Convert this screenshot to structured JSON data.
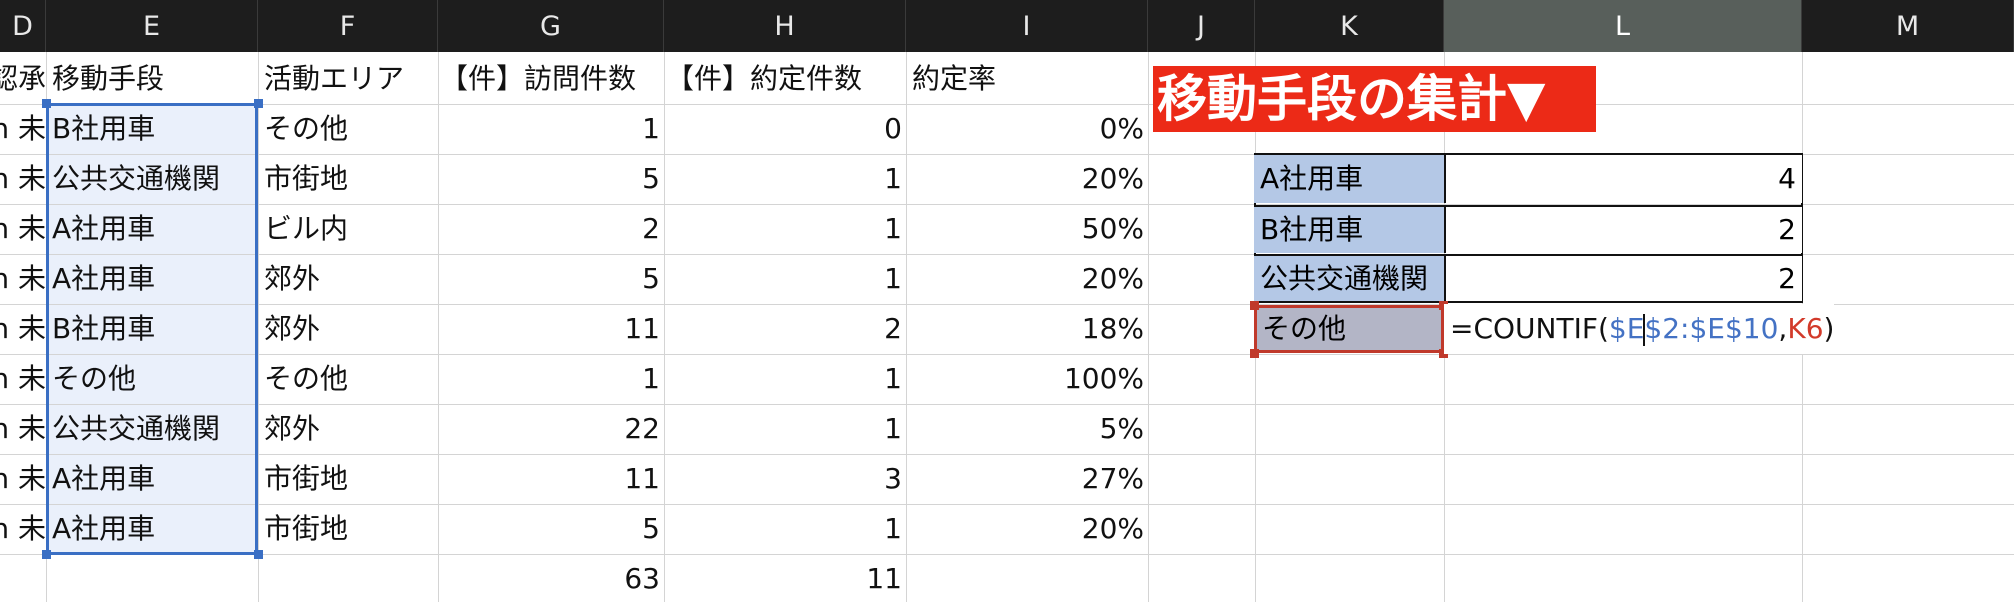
{
  "column_headers": [
    "D",
    "E",
    "F",
    "G",
    "H",
    "I",
    "J",
    "K",
    "L",
    "M"
  ],
  "header_row": {
    "d_partial": "認承",
    "e": "移動手段",
    "f": "活動エリア",
    "g": "【件】訪問件数",
    "h": "【件】約定件数",
    "i": "約定率"
  },
  "rows": [
    {
      "d": "n 未",
      "e": "B社用車",
      "f": "その他",
      "g": "1",
      "h": "0",
      "i": "0%"
    },
    {
      "d": "n 未",
      "e": "公共交通機関",
      "f": "市街地",
      "g": "5",
      "h": "1",
      "i": "20%"
    },
    {
      "d": "n 未",
      "e": "A社用車",
      "f": "ビル内",
      "g": "2",
      "h": "1",
      "i": "50%"
    },
    {
      "d": "n 未",
      "e": "A社用車",
      "f": "郊外",
      "g": "5",
      "h": "1",
      "i": "20%"
    },
    {
      "d": "n 未",
      "e": "B社用車",
      "f": "郊外",
      "g": "11",
      "h": "2",
      "i": "18%"
    },
    {
      "d": "n 未",
      "e": "その他",
      "f": "その他",
      "g": "1",
      "h": "1",
      "i": "100%"
    },
    {
      "d": "n 未",
      "e": "公共交通機関",
      "f": "郊外",
      "g": "22",
      "h": "1",
      "i": "5%"
    },
    {
      "d": "n 未",
      "e": "A社用車",
      "f": "市街地",
      "g": "11",
      "h": "3",
      "i": "27%"
    },
    {
      "d": "n 未",
      "e": "A社用車",
      "f": "市街地",
      "g": "5",
      "h": "1",
      "i": "20%"
    }
  ],
  "totals": {
    "g": "63",
    "h": "11"
  },
  "summary": {
    "title": "移動手段の集計▼",
    "items": [
      {
        "label": "A社用車",
        "value": "4"
      },
      {
        "label": "B社用車",
        "value": "2"
      },
      {
        "label": "公共交通機関",
        "value": "2"
      },
      {
        "label": "その他",
        "value": ""
      }
    ]
  },
  "formula": {
    "prefix": "=COUNTIF(",
    "range_a": "$E",
    "range_b": "$2:$E$10",
    "comma": ",",
    "ref": "K6",
    "suffix": ")"
  },
  "colors": {
    "header_bg": "#1d1d1d",
    "selected_header_bg": "#585f5b",
    "title_bg": "#ec2a17",
    "summary_label_bg": "#b4c8e6",
    "selection_border": "#3a6fc4",
    "active_cell_border": "#c0392b"
  }
}
